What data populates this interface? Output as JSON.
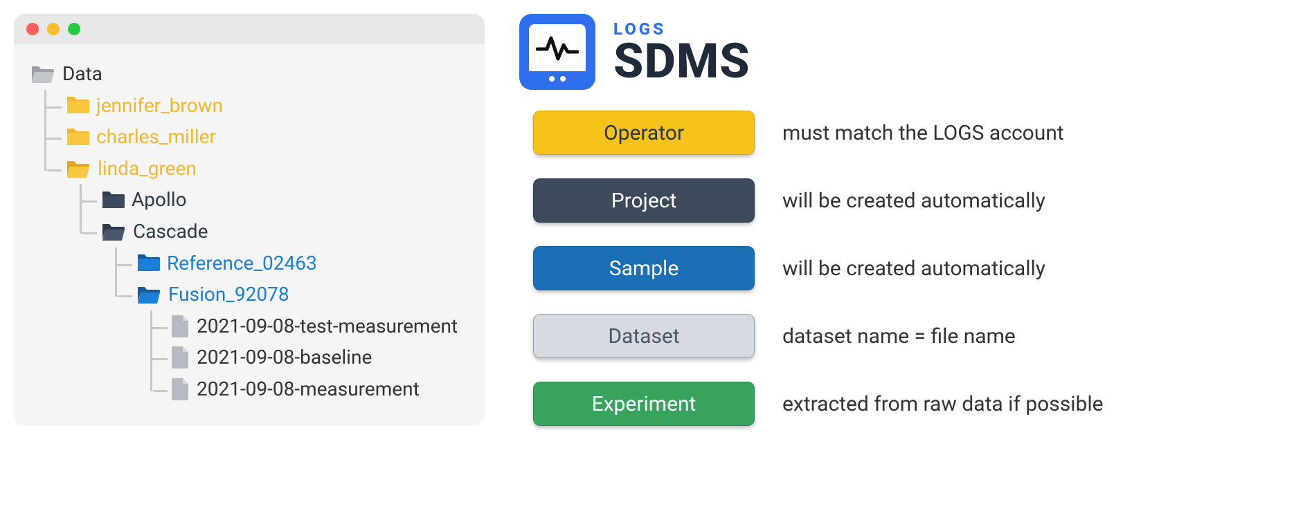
{
  "window": {
    "title": "Data"
  },
  "colors": {
    "operator": "#f7c21a",
    "project": "#3c4a5b",
    "sample": "#1b6fb5",
    "dataset": "#d6dbe1",
    "experiment": "#37a35e",
    "brand_blue": "#2f6fed"
  },
  "tree": {
    "root": {
      "label": "Data"
    },
    "operators": [
      {
        "label": "jennifer_brown"
      },
      {
        "label": "charles_miller"
      },
      {
        "label": "linda_green"
      }
    ],
    "projects": [
      {
        "label": "Apollo"
      },
      {
        "label": "Cascade"
      }
    ],
    "samples": [
      {
        "label": "Reference_02463"
      },
      {
        "label": "Fusion_92078"
      }
    ],
    "datasets": [
      {
        "label": "2021-09-08-test-measurement"
      },
      {
        "label": "2021-09-08-baseline"
      },
      {
        "label": "2021-09-08-measurement"
      }
    ]
  },
  "brand": {
    "logs": "LOGS",
    "sdms": "SDMS"
  },
  "legend": {
    "operator": {
      "label": "Operator",
      "desc": "must match the LOGS account"
    },
    "project": {
      "label": "Project",
      "desc": "will be created automatically"
    },
    "sample": {
      "label": "Sample",
      "desc": "will be created automatically"
    },
    "dataset": {
      "label": "Dataset",
      "desc": "dataset name = file name"
    },
    "experiment": {
      "label": "Experiment",
      "desc": "extracted from raw data if possible"
    }
  }
}
